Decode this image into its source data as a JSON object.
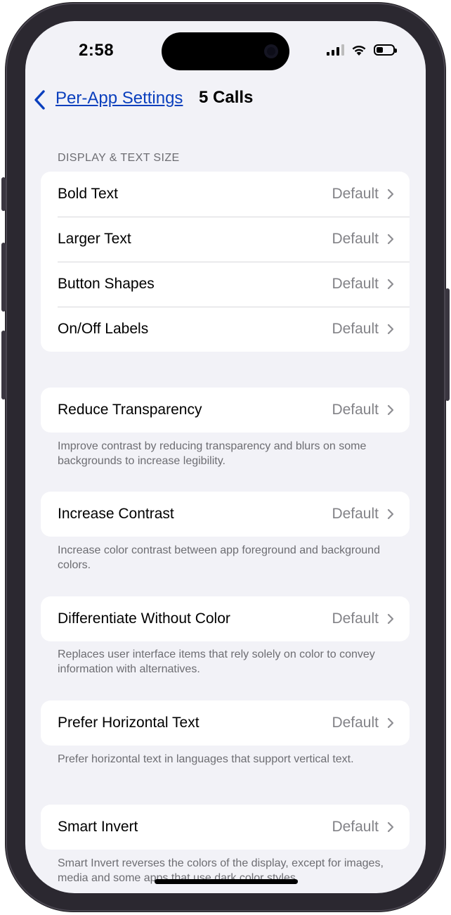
{
  "status_bar": {
    "time": "2:58"
  },
  "nav": {
    "back_label": "Per-App Settings",
    "title": "5 Calls"
  },
  "sections": {
    "display_header": "DISPLAY & TEXT SIZE",
    "display_rows": [
      {
        "label": "Bold Text",
        "value": "Default"
      },
      {
        "label": "Larger Text",
        "value": "Default"
      },
      {
        "label": "Button Shapes",
        "value": "Default"
      },
      {
        "label": "On/Off Labels",
        "value": "Default"
      }
    ],
    "reduce_transparency": {
      "label": "Reduce Transparency",
      "value": "Default",
      "footer": "Improve contrast by reducing transparency and blurs on some backgrounds to increase legibility."
    },
    "increase_contrast": {
      "label": "Increase Contrast",
      "value": "Default",
      "footer": "Increase color contrast between app foreground and background colors."
    },
    "differentiate": {
      "label": "Differentiate Without Color",
      "value": "Default",
      "footer": "Replaces user interface items that rely solely on color to convey information with alternatives."
    },
    "horizontal_text": {
      "label": "Prefer Horizontal Text",
      "value": "Default",
      "footer": "Prefer horizontal text in languages that support vertical text."
    },
    "smart_invert": {
      "label": "Smart Invert",
      "value": "Default",
      "footer": "Smart Invert reverses the colors of the display, except for images, media and some apps that use dark color styles."
    }
  },
  "colors": {
    "accent": "#0a3fbd",
    "background": "#f2f2f7",
    "secondary_text": "#828287"
  }
}
